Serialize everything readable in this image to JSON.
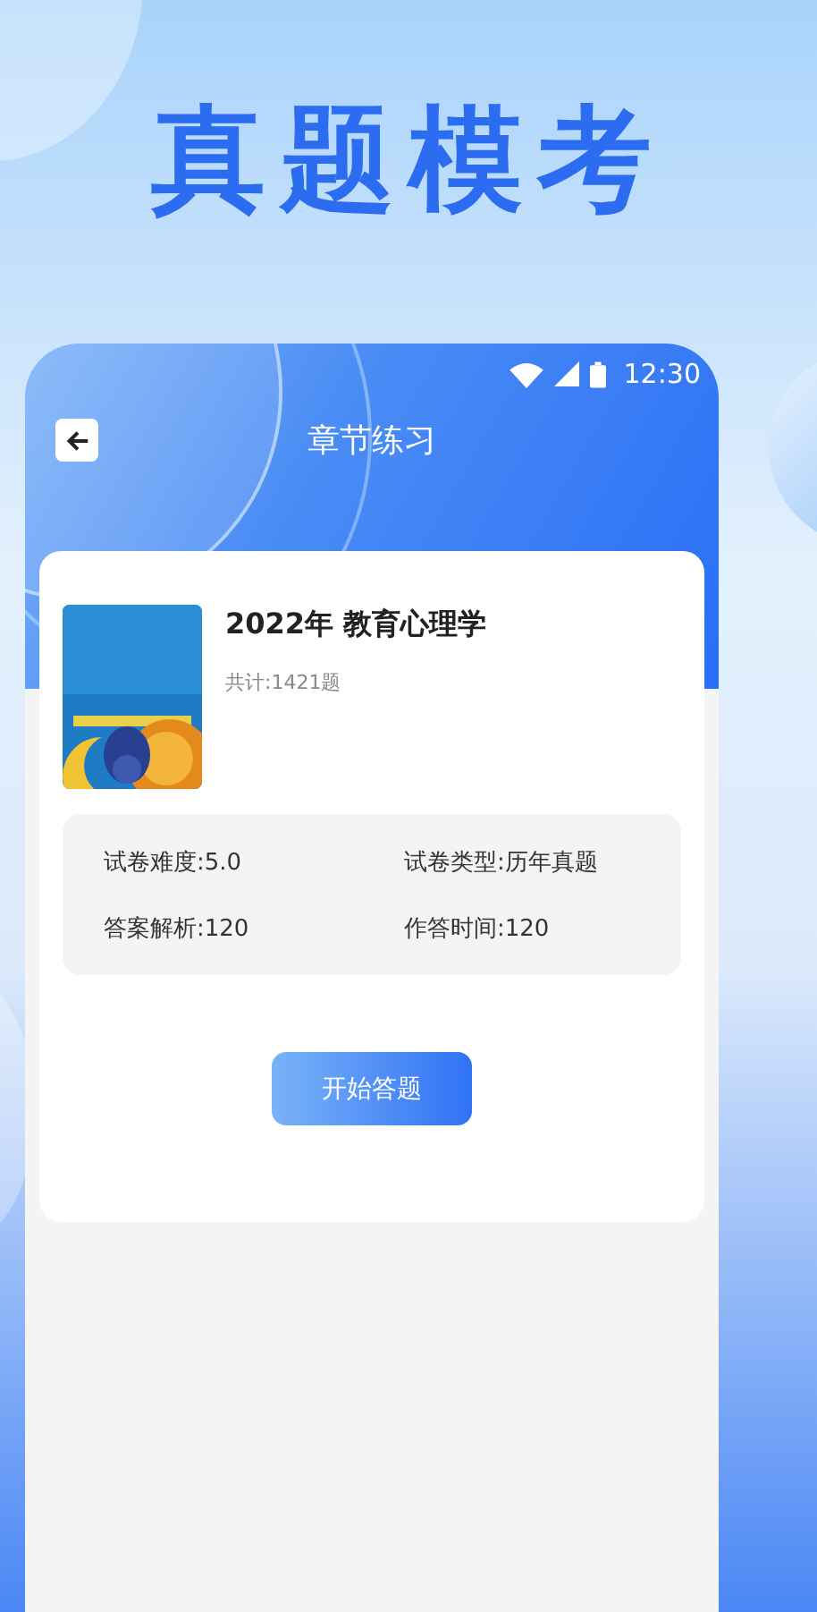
{
  "headline": "真题模考",
  "status_bar": {
    "time": "12:30"
  },
  "header": {
    "title": "章节练习"
  },
  "paper": {
    "title": "2022年 教育心理学",
    "count": "共计:1421题",
    "details": [
      "试卷难度:5.0",
      "试卷类型:历年真题",
      "答案解析:120",
      "作答时间:120"
    ],
    "button": "开始答题"
  }
}
